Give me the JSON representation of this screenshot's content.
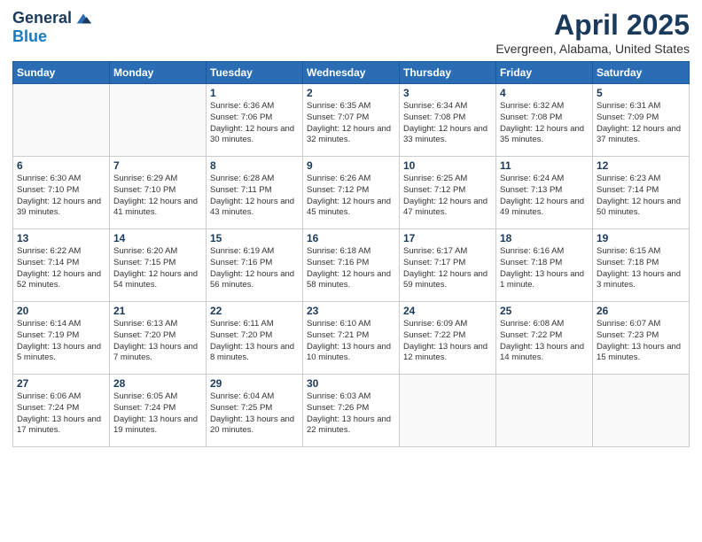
{
  "logo": {
    "general": "General",
    "blue": "Blue"
  },
  "header": {
    "title": "April 2025",
    "subtitle": "Evergreen, Alabama, United States"
  },
  "weekdays": [
    "Sunday",
    "Monday",
    "Tuesday",
    "Wednesday",
    "Thursday",
    "Friday",
    "Saturday"
  ],
  "weeks": [
    [
      {
        "day": "",
        "info": ""
      },
      {
        "day": "",
        "info": ""
      },
      {
        "day": "1",
        "info": "Sunrise: 6:36 AM\nSunset: 7:06 PM\nDaylight: 12 hours and 30 minutes."
      },
      {
        "day": "2",
        "info": "Sunrise: 6:35 AM\nSunset: 7:07 PM\nDaylight: 12 hours and 32 minutes."
      },
      {
        "day": "3",
        "info": "Sunrise: 6:34 AM\nSunset: 7:08 PM\nDaylight: 12 hours and 33 minutes."
      },
      {
        "day": "4",
        "info": "Sunrise: 6:32 AM\nSunset: 7:08 PM\nDaylight: 12 hours and 35 minutes."
      },
      {
        "day": "5",
        "info": "Sunrise: 6:31 AM\nSunset: 7:09 PM\nDaylight: 12 hours and 37 minutes."
      }
    ],
    [
      {
        "day": "6",
        "info": "Sunrise: 6:30 AM\nSunset: 7:10 PM\nDaylight: 12 hours and 39 minutes."
      },
      {
        "day": "7",
        "info": "Sunrise: 6:29 AM\nSunset: 7:10 PM\nDaylight: 12 hours and 41 minutes."
      },
      {
        "day": "8",
        "info": "Sunrise: 6:28 AM\nSunset: 7:11 PM\nDaylight: 12 hours and 43 minutes."
      },
      {
        "day": "9",
        "info": "Sunrise: 6:26 AM\nSunset: 7:12 PM\nDaylight: 12 hours and 45 minutes."
      },
      {
        "day": "10",
        "info": "Sunrise: 6:25 AM\nSunset: 7:12 PM\nDaylight: 12 hours and 47 minutes."
      },
      {
        "day": "11",
        "info": "Sunrise: 6:24 AM\nSunset: 7:13 PM\nDaylight: 12 hours and 49 minutes."
      },
      {
        "day": "12",
        "info": "Sunrise: 6:23 AM\nSunset: 7:14 PM\nDaylight: 12 hours and 50 minutes."
      }
    ],
    [
      {
        "day": "13",
        "info": "Sunrise: 6:22 AM\nSunset: 7:14 PM\nDaylight: 12 hours and 52 minutes."
      },
      {
        "day": "14",
        "info": "Sunrise: 6:20 AM\nSunset: 7:15 PM\nDaylight: 12 hours and 54 minutes."
      },
      {
        "day": "15",
        "info": "Sunrise: 6:19 AM\nSunset: 7:16 PM\nDaylight: 12 hours and 56 minutes."
      },
      {
        "day": "16",
        "info": "Sunrise: 6:18 AM\nSunset: 7:16 PM\nDaylight: 12 hours and 58 minutes."
      },
      {
        "day": "17",
        "info": "Sunrise: 6:17 AM\nSunset: 7:17 PM\nDaylight: 12 hours and 59 minutes."
      },
      {
        "day": "18",
        "info": "Sunrise: 6:16 AM\nSunset: 7:18 PM\nDaylight: 13 hours and 1 minute."
      },
      {
        "day": "19",
        "info": "Sunrise: 6:15 AM\nSunset: 7:18 PM\nDaylight: 13 hours and 3 minutes."
      }
    ],
    [
      {
        "day": "20",
        "info": "Sunrise: 6:14 AM\nSunset: 7:19 PM\nDaylight: 13 hours and 5 minutes."
      },
      {
        "day": "21",
        "info": "Sunrise: 6:13 AM\nSunset: 7:20 PM\nDaylight: 13 hours and 7 minutes."
      },
      {
        "day": "22",
        "info": "Sunrise: 6:11 AM\nSunset: 7:20 PM\nDaylight: 13 hours and 8 minutes."
      },
      {
        "day": "23",
        "info": "Sunrise: 6:10 AM\nSunset: 7:21 PM\nDaylight: 13 hours and 10 minutes."
      },
      {
        "day": "24",
        "info": "Sunrise: 6:09 AM\nSunset: 7:22 PM\nDaylight: 13 hours and 12 minutes."
      },
      {
        "day": "25",
        "info": "Sunrise: 6:08 AM\nSunset: 7:22 PM\nDaylight: 13 hours and 14 minutes."
      },
      {
        "day": "26",
        "info": "Sunrise: 6:07 AM\nSunset: 7:23 PM\nDaylight: 13 hours and 15 minutes."
      }
    ],
    [
      {
        "day": "27",
        "info": "Sunrise: 6:06 AM\nSunset: 7:24 PM\nDaylight: 13 hours and 17 minutes."
      },
      {
        "day": "28",
        "info": "Sunrise: 6:05 AM\nSunset: 7:24 PM\nDaylight: 13 hours and 19 minutes."
      },
      {
        "day": "29",
        "info": "Sunrise: 6:04 AM\nSunset: 7:25 PM\nDaylight: 13 hours and 20 minutes."
      },
      {
        "day": "30",
        "info": "Sunrise: 6:03 AM\nSunset: 7:26 PM\nDaylight: 13 hours and 22 minutes."
      },
      {
        "day": "",
        "info": ""
      },
      {
        "day": "",
        "info": ""
      },
      {
        "day": "",
        "info": ""
      }
    ]
  ]
}
